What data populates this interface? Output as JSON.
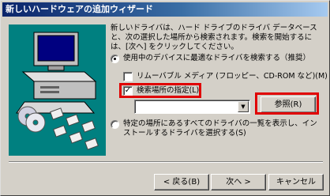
{
  "window": {
    "title": "新しいハードウェアの追加ウィザード"
  },
  "description": "新しいドライバは、ハード ドライブのドライバ データベースと、次の選択した場所から検索されます。検索を開始するには、[次へ] をクリックしてください。",
  "options": {
    "search_best": "使用中のデバイスに最適なドライバを検索する（推奨）",
    "removable_media": "リムーバブル メディア (フロッピー、CD-ROM など)(M)",
    "specify_location": "検索場所の指定(L):",
    "browse_button": "参照(R)",
    "list_all": "特定の場所にあるすべてのドライバの一覧を表示し、インストールするドライバを選択する(S)"
  },
  "buttons": {
    "back": "< 戻る(B)",
    "next": "次へ >",
    "cancel": "キャンセル"
  },
  "location": {
    "value": ""
  },
  "colors": {
    "highlight": "#e00000",
    "art_bg": "#008080",
    "titlebar": "#0a246a"
  }
}
